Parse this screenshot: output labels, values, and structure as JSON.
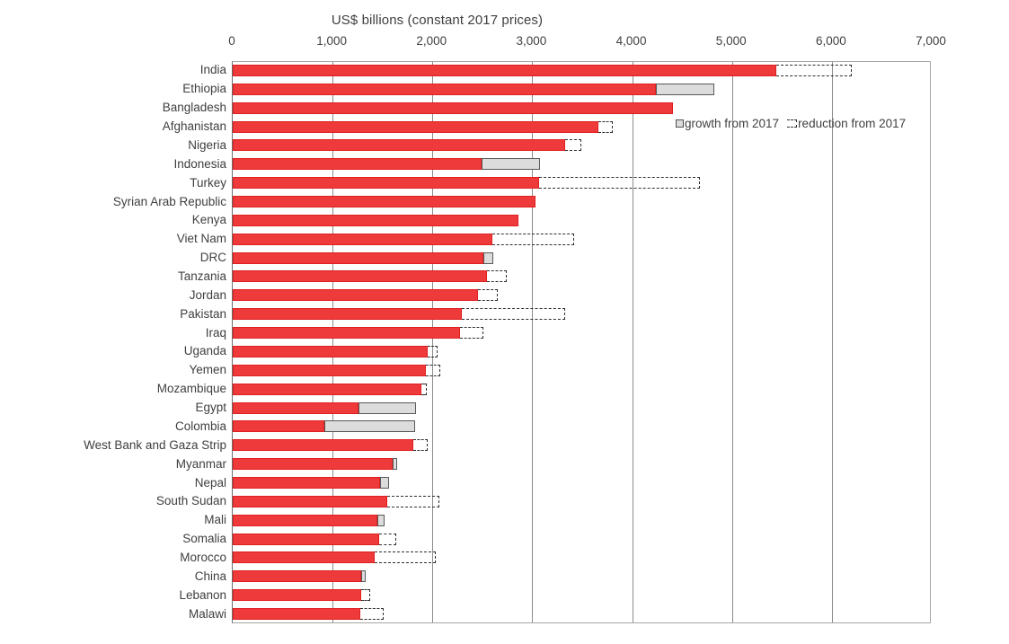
{
  "chart_data": {
    "type": "bar",
    "orientation": "horizontal",
    "title": "US$ billions (constant 2017 prices)",
    "xlabel": "",
    "ylabel": "",
    "xlim": [
      0,
      7000
    ],
    "xticks": [
      0,
      1000,
      2000,
      3000,
      4000,
      5000,
      6000,
      7000
    ],
    "xticklabels": [
      "0",
      "1,000",
      "2,000",
      "3,000",
      "4,000",
      "5,000",
      "6,000",
      "7,000"
    ],
    "grid": true,
    "legend_position": "inside-top-right",
    "colors": {
      "baseline": "#EE3A3A",
      "growth": "#DCDCDC",
      "growth_outline": "#5a5a5a",
      "reduction_outline": "#2e2e2e",
      "gridline": "#8c8c8c",
      "text": "#3f3f3f"
    },
    "legend": [
      {
        "key": "growth",
        "label": "growth from 2017"
      },
      {
        "key": "reduction",
        "label": "reduction from 2017"
      }
    ],
    "series_names": [
      "baseline",
      "growth from 2017",
      "reduction from 2017"
    ],
    "categories": [
      "India",
      "Ethiopia",
      "Bangladesh",
      "Afghanistan",
      "Nigeria",
      "Indonesia",
      "Turkey",
      "Syrian Arab Republic",
      "Kenya",
      "Viet Nam",
      "DRC",
      "Tanzania",
      "Jordan",
      "Pakistan",
      "Iraq",
      "Uganda",
      "Yemen",
      "Mozambique",
      "Egypt",
      "Colombia",
      "West Bank and Gaza Strip",
      "Myanmar",
      "Nepal",
      "South Sudan",
      "Mali",
      "Somalia",
      "Morocco",
      "China",
      "Lebanon",
      "Malawi"
    ],
    "values": [
      {
        "category": "India",
        "baseline": 5440,
        "growth": 0,
        "reduction": 6200
      },
      {
        "category": "Ethiopia",
        "baseline": 4240,
        "growth": 4825,
        "reduction": 0
      },
      {
        "category": "Bangladesh",
        "baseline": 4410,
        "growth": 0,
        "reduction": 0
      },
      {
        "category": "Afghanistan",
        "baseline": 3660,
        "growth": 0,
        "reduction": 3810
      },
      {
        "category": "Nigeria",
        "baseline": 3330,
        "growth": 0,
        "reduction": 3490
      },
      {
        "category": "Indonesia",
        "baseline": 2490,
        "growth": 3080,
        "reduction": 0
      },
      {
        "category": "Turkey",
        "baseline": 3070,
        "growth": 0,
        "reduction": 4680
      },
      {
        "category": "Syrian Arab Republic",
        "baseline": 3030,
        "growth": 0,
        "reduction": 0
      },
      {
        "category": "Kenya",
        "baseline": 2860,
        "growth": 0,
        "reduction": 0
      },
      {
        "category": "Viet Nam",
        "baseline": 2600,
        "growth": 0,
        "reduction": 3420
      },
      {
        "category": "DRC",
        "baseline": 2510,
        "growth": 2610,
        "reduction": 0
      },
      {
        "category": "Tanzania",
        "baseline": 2550,
        "growth": 0,
        "reduction": 2740
      },
      {
        "category": "Jordan",
        "baseline": 2460,
        "growth": 0,
        "reduction": 2650
      },
      {
        "category": "Pakistan",
        "baseline": 2290,
        "growth": 0,
        "reduction": 3330
      },
      {
        "category": "Iraq",
        "baseline": 2280,
        "growth": 0,
        "reduction": 2510
      },
      {
        "category": "Uganda",
        "baseline": 1950,
        "growth": 0,
        "reduction": 2050
      },
      {
        "category": "Yemen",
        "baseline": 1930,
        "growth": 0,
        "reduction": 2080
      },
      {
        "category": "Mozambique",
        "baseline": 1890,
        "growth": 0,
        "reduction": 1940
      },
      {
        "category": "Egypt",
        "baseline": 1260,
        "growth": 1840,
        "reduction": 0
      },
      {
        "category": "Colombia",
        "baseline": 920,
        "growth": 1830,
        "reduction": 0
      },
      {
        "category": "West Bank and Gaza Strip",
        "baseline": 1810,
        "growth": 0,
        "reduction": 1950
      },
      {
        "category": "Myanmar",
        "baseline": 1600,
        "growth": 1650,
        "reduction": 0
      },
      {
        "category": "Nepal",
        "baseline": 1480,
        "growth": 1570,
        "reduction": 0
      },
      {
        "category": "South Sudan",
        "baseline": 1550,
        "growth": 0,
        "reduction": 2070
      },
      {
        "category": "Mali",
        "baseline": 1450,
        "growth": 1520,
        "reduction": 0
      },
      {
        "category": "Somalia",
        "baseline": 1470,
        "growth": 0,
        "reduction": 1640
      },
      {
        "category": "Morocco",
        "baseline": 1420,
        "growth": 0,
        "reduction": 2030
      },
      {
        "category": "China",
        "baseline": 1290,
        "growth": 1330,
        "reduction": 0
      },
      {
        "category": "Lebanon",
        "baseline": 1290,
        "growth": 0,
        "reduction": 1380
      },
      {
        "category": "Malawi",
        "baseline": 1280,
        "growth": 0,
        "reduction": 1510
      }
    ]
  }
}
